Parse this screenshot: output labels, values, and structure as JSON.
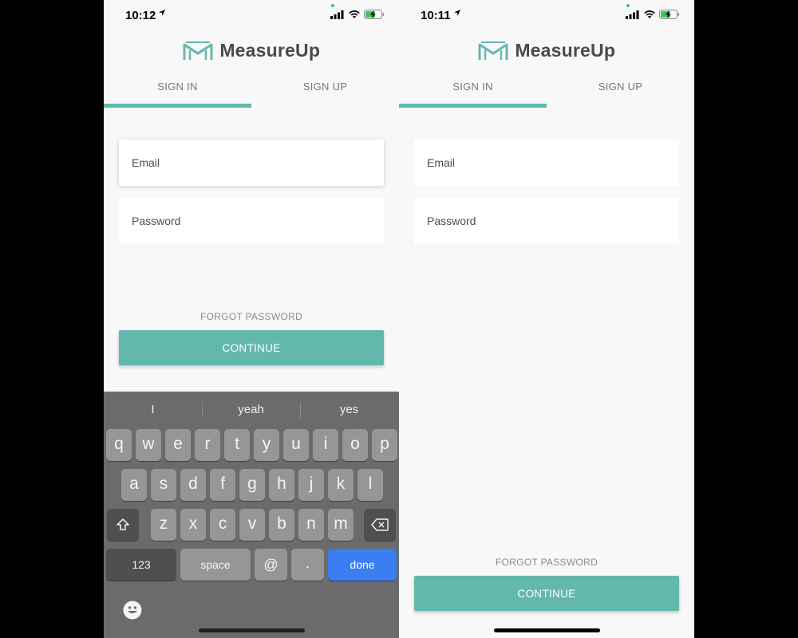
{
  "left_screen": {
    "status": {
      "time": "10:12"
    },
    "brand": {
      "name": "MeasureUp"
    },
    "tabs": [
      {
        "label": "SIGN IN"
      },
      {
        "label": "SIGN UP"
      }
    ],
    "email_placeholder": "Email",
    "password_placeholder": "Password",
    "forgot_label": "FORGOT PASSWORD",
    "continue_label": "CONTINUE",
    "keyboard": {
      "suggestions": [
        "I",
        "yeah",
        "yes"
      ],
      "row1": [
        "q",
        "w",
        "e",
        "r",
        "t",
        "y",
        "u",
        "i",
        "o",
        "p"
      ],
      "row2": [
        "a",
        "s",
        "d",
        "f",
        "g",
        "h",
        "j",
        "k",
        "l"
      ],
      "row3": [
        "z",
        "x",
        "c",
        "v",
        "b",
        "n",
        "m"
      ],
      "numbers_label": "123",
      "space_label": "space",
      "at_label": "@",
      "dot_label": ".",
      "done_label": "done"
    }
  },
  "right_screen": {
    "status": {
      "time": "10:11"
    },
    "brand": {
      "name": "MeasureUp"
    },
    "tabs": [
      {
        "label": "SIGN IN"
      },
      {
        "label": "SIGN UP"
      }
    ],
    "email_placeholder": "Email",
    "password_placeholder": "Password",
    "forgot_label": "FORGOT PASSWORD",
    "continue_label": "CONTINUE"
  },
  "colors": {
    "accent": "#63b8ad",
    "done_key": "#3a7ef2",
    "background": "#f8f8f8"
  },
  "icons": [
    "location-arrow-icon",
    "signal-icon",
    "wifi-icon",
    "battery-charging-icon",
    "measureup-logo-icon",
    "shift-icon",
    "backspace-icon",
    "emoji-icon"
  ]
}
